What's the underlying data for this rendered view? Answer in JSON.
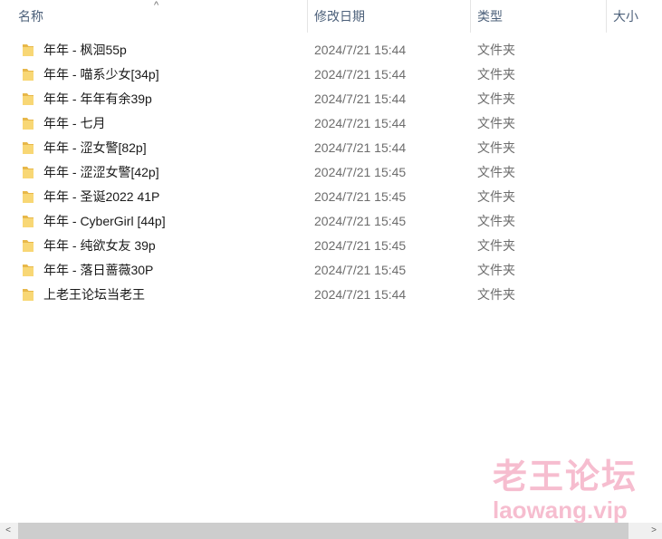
{
  "columns": {
    "name": "名称",
    "date": "修改日期",
    "type": "类型",
    "size": "大小"
  },
  "sort_indicator": "^",
  "files": [
    {
      "name": "年年 - 枫洄55p",
      "date": "2024/7/21 15:44",
      "type": "文件夹",
      "icon": "folder-icon"
    },
    {
      "name": "年年 - 喵系少女[34p]",
      "date": "2024/7/21 15:44",
      "type": "文件夹",
      "icon": "folder-icon"
    },
    {
      "name": "年年 - 年年有余39p",
      "date": "2024/7/21 15:44",
      "type": "文件夹",
      "icon": "folder-icon"
    },
    {
      "name": "年年 - 七月",
      "date": "2024/7/21 15:44",
      "type": "文件夹",
      "icon": "folder-icon"
    },
    {
      "name": "年年 - 涩女警[82p]",
      "date": "2024/7/21 15:44",
      "type": "文件夹",
      "icon": "folder-icon"
    },
    {
      "name": "年年 - 涩涩女警[42p]",
      "date": "2024/7/21 15:45",
      "type": "文件夹",
      "icon": "folder-icon"
    },
    {
      "name": "年年 - 圣诞2022 41P",
      "date": "2024/7/21 15:45",
      "type": "文件夹",
      "icon": "folder-icon"
    },
    {
      "name": "年年 - CyberGirl [44p]",
      "date": "2024/7/21 15:45",
      "type": "文件夹",
      "icon": "folder-icon"
    },
    {
      "name": "年年 - 纯欲女友 39p",
      "date": "2024/7/21 15:45",
      "type": "文件夹",
      "icon": "folder-icon"
    },
    {
      "name": "年年 - 落日蔷薇30P",
      "date": "2024/7/21 15:45",
      "type": "文件夹",
      "icon": "folder-icon"
    },
    {
      "name": "上老王论坛当老王",
      "date": "2024/7/21 15:44",
      "type": "文件夹",
      "icon": "folder-icon"
    }
  ],
  "watermark": {
    "cn": "老王论坛",
    "en": "laowang.vip"
  },
  "scrollbar": {
    "left_arrow": "<",
    "right_arrow": ">"
  },
  "colors": {
    "folder_body": "#f8d775",
    "folder_tab": "#e8b84a",
    "header_text": "#4c607a",
    "watermark": "#f4a8c0"
  }
}
